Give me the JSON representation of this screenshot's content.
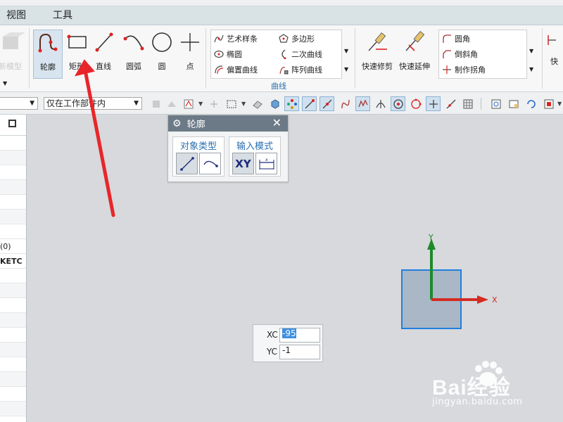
{
  "menu": [
    "视图",
    "工具"
  ],
  "ribbon": {
    "ghost_label": "新模型",
    "big_buttons": [
      {
        "label": "轮廓",
        "icon": "profile-icon",
        "active": true
      },
      {
        "label": "矩形",
        "icon": "rectangle-icon"
      },
      {
        "label": "直线",
        "icon": "line-icon"
      },
      {
        "label": "圆弧",
        "icon": "arc-icon"
      },
      {
        "label": "圆",
        "icon": "circle-icon"
      },
      {
        "label": "点",
        "icon": "point-icon"
      }
    ],
    "curve_items": [
      {
        "label": "艺术样条",
        "icon": "studio-spline-icon"
      },
      {
        "label": "多边形",
        "icon": "polygon-icon"
      },
      {
        "label": "椭圆",
        "icon": "ellipse-icon"
      },
      {
        "label": "二次曲线",
        "icon": "conic-icon"
      },
      {
        "label": "偏置曲线",
        "icon": "offset-curve-icon"
      },
      {
        "label": "阵列曲线",
        "icon": "pattern-curve-icon"
      }
    ],
    "curve_group_label": "曲线",
    "edit_buttons": [
      {
        "label": "快速修剪",
        "icon": "quick-trim-icon"
      },
      {
        "label": "快速延伸",
        "icon": "quick-extend-icon"
      }
    ],
    "corner_items": [
      {
        "label": "圆角",
        "icon": "fillet-icon"
      },
      {
        "label": "倒斜角",
        "icon": "chamfer-icon"
      },
      {
        "label": "制作拐角",
        "icon": "make-corner-icon"
      }
    ],
    "far_right_label": "快"
  },
  "toolbar": {
    "filter_combo": "",
    "scope_combo": "仅在工作部件内"
  },
  "left_panel": {
    "rows": [
      "",
      "",
      "",
      "",
      "",
      "",
      "",
      "(0)",
      "KETC",
      "",
      "",
      "",
      "",
      "",
      "",
      "",
      "",
      "",
      "",
      ""
    ]
  },
  "dialog": {
    "title": "轮廓",
    "section_object_type": "对象类型",
    "section_input_mode": "输入模式",
    "xy_label": "XY"
  },
  "coords": {
    "xc_label": "XC",
    "xc_value": "-95",
    "yc_label": "YC",
    "yc_value": "-1"
  },
  "triad": {
    "x_label": "X",
    "y_label": "Y"
  },
  "watermark": {
    "brand": "Bai经验",
    "url": "jingyan.baidu.com"
  },
  "colors": {
    "accent_blue": "#2a6fb0",
    "arrow_red": "#e8262a",
    "triad_green": "#1d8a2c",
    "triad_red": "#d42b23"
  }
}
